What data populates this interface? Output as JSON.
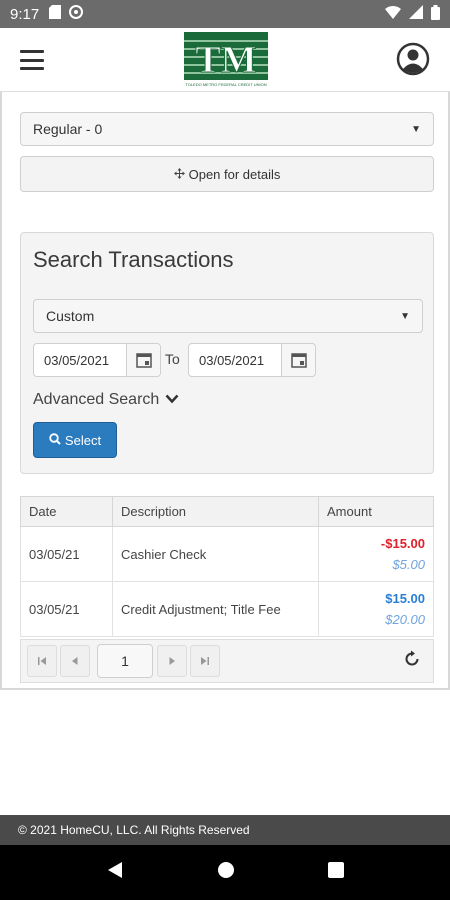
{
  "status_bar": {
    "time": "9:17"
  },
  "header": {
    "logo_text": "TM",
    "logo_subtext": "TOLEDO METRO FEDERAL CREDIT UNION"
  },
  "account": {
    "selected": "Regular - 0",
    "details_label": "Open for details"
  },
  "search": {
    "title": "Search Transactions",
    "range_selected": "Custom",
    "from_date": "03/05/2021",
    "to_label": "To",
    "to_date": "03/05/2021",
    "advanced_label": "Advanced Search",
    "select_label": "Select"
  },
  "table": {
    "headers": [
      "Date",
      "Description",
      "Amount"
    ],
    "rows": [
      {
        "date": "03/05/21",
        "description": "Cashier Check",
        "amount": "-$15.00",
        "balance": "$5.00"
      },
      {
        "date": "03/05/21",
        "description": "Credit Adjustment; Title Fee",
        "amount": "$15.00",
        "balance": "$20.00"
      }
    ]
  },
  "pager": {
    "page": "1"
  },
  "footer": {
    "copyright": "© 2021 HomeCU, LLC. All Rights Reserved"
  },
  "colors": {
    "accent": "#2b7bbf",
    "negative": "#e0202a",
    "positive": "#2a7fd4",
    "brand": "#1a6a3a"
  }
}
